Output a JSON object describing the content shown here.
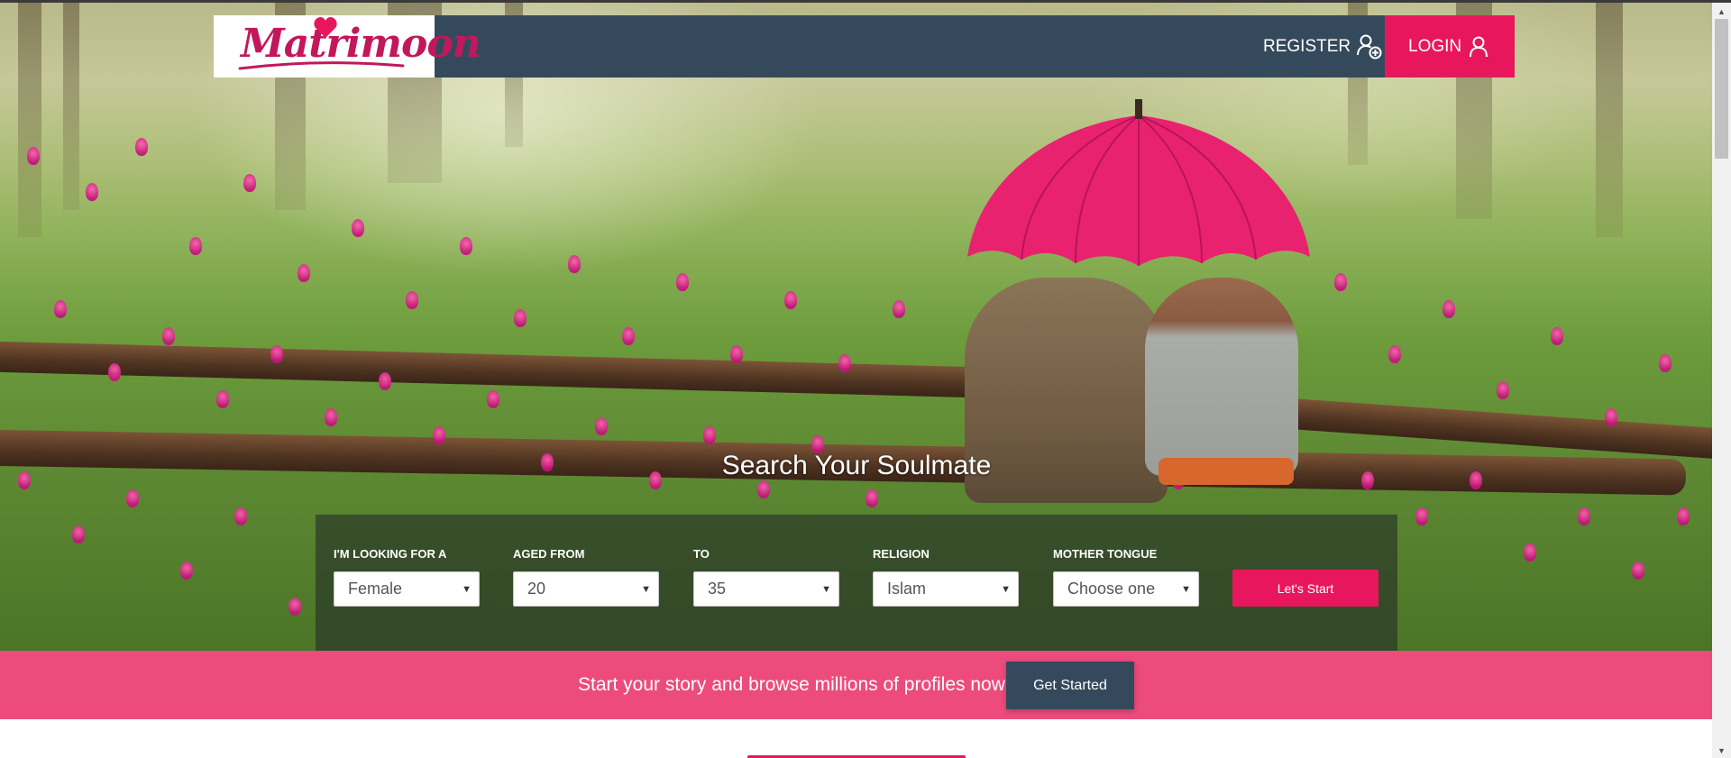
{
  "brand": {
    "name": "Matrimoon"
  },
  "nav": {
    "register": "REGISTER",
    "login": "LOGIN"
  },
  "search": {
    "title": "Search Your Soulmate",
    "fields": [
      {
        "label": "I'M LOOKING FOR A",
        "value": "Female"
      },
      {
        "label": "AGED FROM",
        "value": "20"
      },
      {
        "label": "TO",
        "value": "35"
      },
      {
        "label": "RELIGION",
        "value": "Islam"
      },
      {
        "label": "MOTHER TONGUE",
        "value": "Choose one"
      }
    ],
    "submit": "Let's Start"
  },
  "cta": {
    "text": "Start your story and browse millions of profiles now!",
    "button": "Get Started"
  },
  "colors": {
    "accent": "#e8175d",
    "nav_bg": "#344a5c",
    "band": "#ee4b7d"
  },
  "icons": {
    "register": "add-user-icon",
    "login": "user-icon",
    "dropdown": "caret-down-icon"
  }
}
